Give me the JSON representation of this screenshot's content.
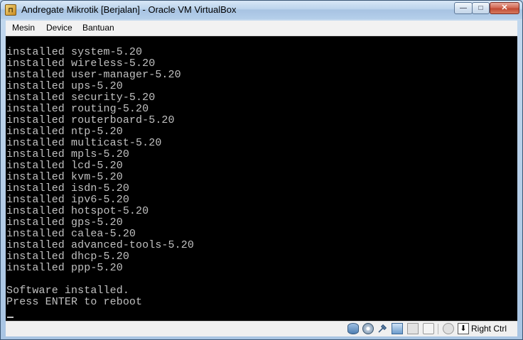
{
  "window": {
    "title": "Andregate Mikrotik [Berjalan] - Oracle VM VirtualBox",
    "app_icon_glyph": "⊓",
    "minimize_glyph": "—",
    "maximize_glyph": "□",
    "close_glyph": "✕"
  },
  "menu": {
    "items": [
      {
        "label": "Mesin"
      },
      {
        "label": "Device"
      },
      {
        "label": "Bantuan"
      }
    ]
  },
  "console": {
    "lines": [
      "installed system-5.20",
      "installed wireless-5.20",
      "installed user-manager-5.20",
      "installed ups-5.20",
      "installed security-5.20",
      "installed routing-5.20",
      "installed routerboard-5.20",
      "installed ntp-5.20",
      "installed multicast-5.20",
      "installed mpls-5.20",
      "installed lcd-5.20",
      "installed kvm-5.20",
      "installed isdn-5.20",
      "installed ipv6-5.20",
      "installed hotspot-5.20",
      "installed gps-5.20",
      "installed calea-5.20",
      "installed advanced-tools-5.20",
      "installed dhcp-5.20",
      "installed ppp-5.20",
      "",
      "Software installed.",
      "Press ENTER to reboot"
    ]
  },
  "statusbar": {
    "icons": [
      "hard-disk-icon",
      "cd-drive-icon",
      "usb-icon",
      "network-icon",
      "shared-folder-icon",
      "display-icon",
      "mouse-integration-icon",
      "keyboard-capture-icon"
    ],
    "key_glyph": "⬇",
    "host_key": "Right Ctrl"
  }
}
